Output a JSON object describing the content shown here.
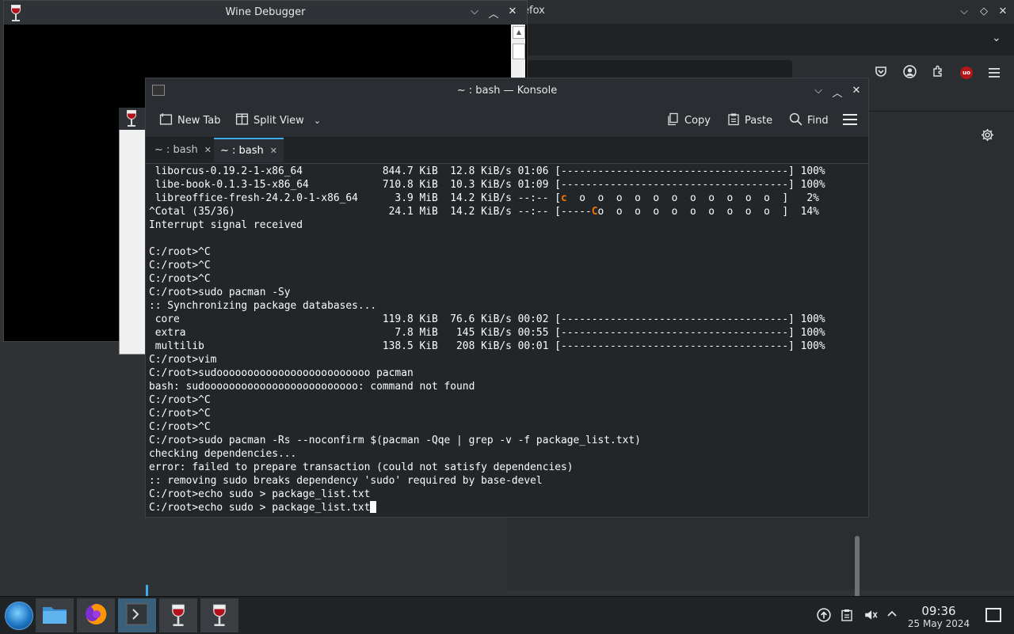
{
  "firefox": {
    "title_fragment": "efox",
    "controls": {
      "minimize": "⌵",
      "maximize": "◇",
      "close": "✕"
    },
    "tab_chevron": "⌄",
    "toolbar_icons": [
      "pocket-icon",
      "account-icon",
      "extensions-icon",
      "ublock-icon",
      "menu-icon"
    ],
    "ublock_label": "uo"
  },
  "wine": {
    "title": "Wine Debugger",
    "controls": {
      "minimize": "⌵",
      "maximize": "︿",
      "close": "✕"
    }
  },
  "konsole": {
    "title": "~ : bash — Konsole",
    "controls": {
      "minimize": "⌵",
      "maximize": "︿",
      "close": "✕"
    },
    "toolbar": {
      "new_tab": "New Tab",
      "split_view": "Split View",
      "copy": "Copy",
      "paste": "Paste",
      "find": "Find"
    },
    "tabs": [
      {
        "label": "~ : bash",
        "active": false
      },
      {
        "label": "~ : bash",
        "active": true
      }
    ],
    "terminal_lines": [
      " liborcus-0.19.2-1-x86_64             844.7 KiB  12.8 KiB/s 01:06 [-------------------------------------] 100%",
      " libe-book-0.1.3-15-x86_64            710.8 KiB  10.3 KiB/s 01:09 [-------------------------------------] 100%",
      " libreoffice-fresh-24.2.0-1-x86_64      3.9 MiB  14.2 KiB/s --:-- [c  o  o  o  o  o  o  o  o  o  o  o  ]   2%",
      "^Cotal (35/36)                         24.1 MiB  14.2 KiB/s --:-- [-----Co  o  o  o  o  o  o  o  o  o  ]  14%",
      "Interrupt signal received",
      "",
      "C:/root>^C",
      "C:/root>^C",
      "C:/root>^C",
      "C:/root>sudo pacman -Sy",
      ":: Synchronizing package databases...",
      " core                                 119.8 KiB  76.6 KiB/s 00:02 [-------------------------------------] 100%",
      " extra                                  7.8 MiB   145 KiB/s 00:55 [-------------------------------------] 100%",
      " multilib                             138.5 KiB   208 KiB/s 00:01 [-------------------------------------] 100%",
      "C:/root>vim",
      "C:/root>sudooooooooooooooooooooooooo pacman",
      "bash: sudooooooooooooooooooooooooo: command not found",
      "C:/root>^C",
      "C:/root>^C",
      "C:/root>^C",
      "C:/root>sudo pacman -Rs --noconfirm $(pacman -Qqe | grep -v -f package_list.txt)",
      "checking dependencies...",
      "error: failed to prepare transaction (could not satisfy dependencies)",
      ":: removing sudo breaks dependency 'sudo' required by base-devel",
      "C:/root>echo sudo > package_list.txt",
      "C:/root>echo sudo > package_list.txt"
    ],
    "highlight_color": "#f67400"
  },
  "taskbar": {
    "items": [
      "start-menu",
      "file-manager",
      "firefox",
      "konsole",
      "wine-1",
      "wine-2"
    ],
    "clock_time": "09:36",
    "clock_date": "25 May 2024"
  }
}
